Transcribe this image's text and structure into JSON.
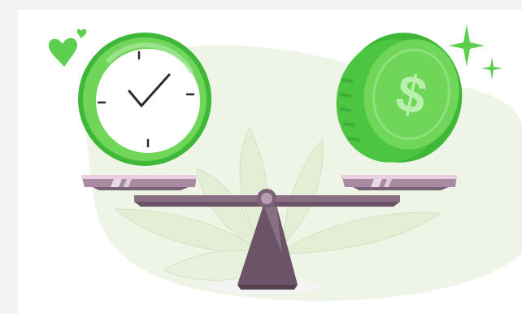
{
  "illustration": {
    "subject": "balance-scale-time-vs-money",
    "left_icon": "clock-icon",
    "right_icon": "dollar-coin-icon",
    "coin_symbol": "$",
    "colors": {
      "accent_green": "#6fd65a",
      "dark_green": "#3fb83a",
      "leaf_pale": "#e6f0d8",
      "scale_plum": "#8a6f84",
      "scale_dark": "#5f4a5c",
      "scale_pink": "#e9cfe0"
    }
  }
}
